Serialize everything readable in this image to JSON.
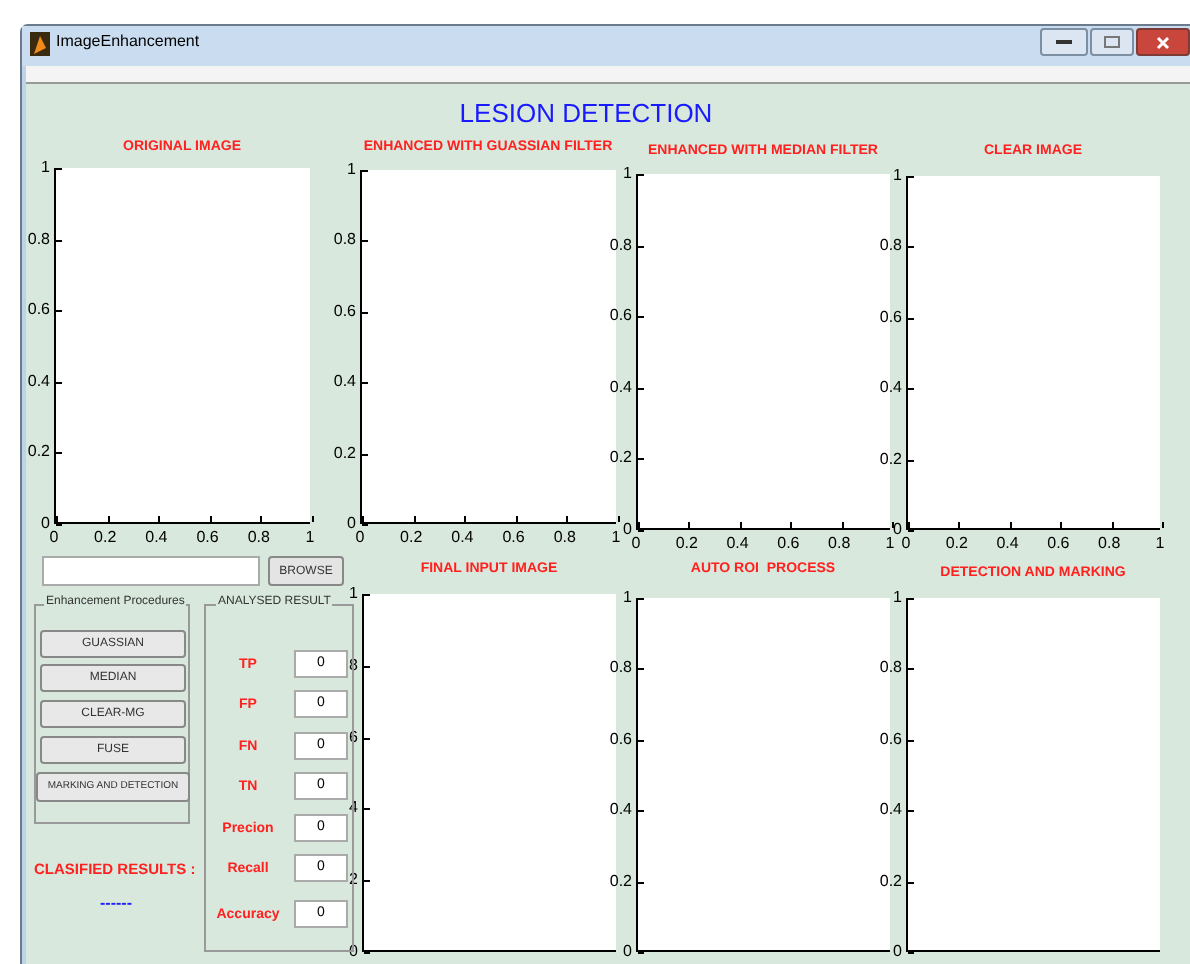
{
  "window": {
    "title": "ImageEnhancement"
  },
  "heading": "LESION DETECTION",
  "axes": [
    {
      "title": "ORIGINAL IMAGE",
      "yticks": [
        "1",
        "0.8",
        "0.6",
        "0.4",
        "0.2",
        "0"
      ],
      "xticks": [
        "0",
        "0.2",
        "0.4",
        "0.6",
        "0.8",
        "1"
      ]
    },
    {
      "title": "ENHANCED WITH GUASSIAN FILTER",
      "yticks": [
        "1",
        "0.8",
        "0.6",
        "0.4",
        "0.2",
        "0"
      ],
      "xticks": [
        "0",
        "0.2",
        "0.4",
        "0.6",
        "0.8",
        "1"
      ]
    },
    {
      "title": "ENHANCED WITH MEDIAN FILTER",
      "yticks": [
        "1",
        "0.8",
        "0.6",
        "0.4",
        "0.2",
        "0"
      ],
      "xticks": [
        "0",
        "0.2",
        "0.4",
        "0.6",
        "0.8",
        "1"
      ]
    },
    {
      "title": "CLEAR IMAGE",
      "yticks": [
        "1",
        "0.8",
        "0.6",
        "0.4",
        "0.2",
        "0"
      ],
      "xticks": [
        "0",
        "0.2",
        "0.4",
        "0.6",
        "0.8",
        "1"
      ]
    },
    {
      "title": "FINAL INPUT IMAGE",
      "yticks": [
        "1",
        "8",
        "6",
        "4",
        "2",
        "0"
      ]
    },
    {
      "title": "AUTO ROI  PROCESS",
      "yticks": [
        "1",
        "0.8",
        "0.6",
        "0.4",
        "0.2",
        "0"
      ]
    },
    {
      "title": "DETECTION AND MARKING",
      "yticks": [
        "1",
        "0.8",
        "0.6",
        "0.4",
        "0.2",
        "0"
      ]
    }
  ],
  "browse_button": "BROWSE",
  "enhancement_panel": {
    "title": "Enhancement Procedures",
    "buttons": [
      "GUASSIAN",
      "MEDIAN",
      "CLEAR-MG",
      "FUSE",
      "MARKING AND DETECTION"
    ]
  },
  "analysed_panel": {
    "title": "ANALYSED RESULT",
    "rows": [
      {
        "label": "TP",
        "value": "0"
      },
      {
        "label": "FP",
        "value": "0"
      },
      {
        "label": "FN",
        "value": "0"
      },
      {
        "label": "TN",
        "value": "0"
      },
      {
        "label": "Precion",
        "value": "0"
      },
      {
        "label": "Recall",
        "value": "0"
      },
      {
        "label": "Accuracy",
        "value": "0"
      }
    ]
  },
  "classified": {
    "label": "CLASIFIED RESULTS :",
    "value": "------"
  }
}
